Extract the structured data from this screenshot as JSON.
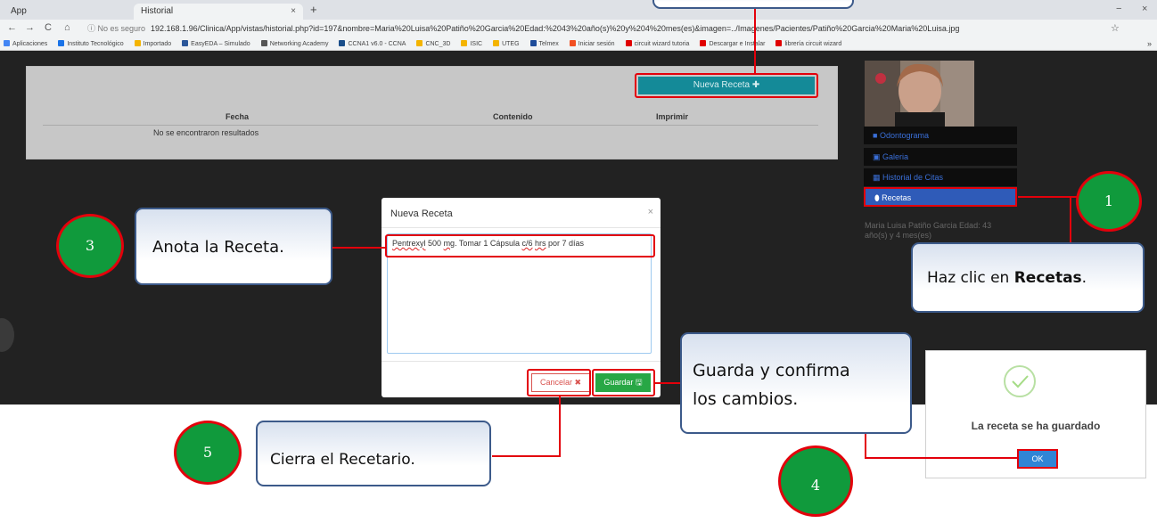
{
  "browser": {
    "tabs": [
      {
        "label": "App",
        "close": "×"
      },
      {
        "label": "Historial",
        "close": "×"
      }
    ],
    "new_tab": "+",
    "window_controls": [
      "−",
      "×"
    ],
    "nav": {
      "back": "←",
      "forward": "→",
      "reload": "C",
      "home": "⌂"
    },
    "security": "ⓘ No es seguro",
    "url": "192.168.1.96/Clinica/App/vistas/historial.php?id=197&nombre=Maria%20Luisa%20Patiño%20Garcia%20Edad:%2043%20año(s)%20y%204%20mes(es)&imagen=../Imagenes/Pacientes/Patiño%20Garcia%20Maria%20Luisa.jpg",
    "star": "☆",
    "bookmarks": [
      {
        "label": "Aplicaciones",
        "color": "#4285f4"
      },
      {
        "label": "Instituto Tecnológico",
        "color": "#1a73e8"
      },
      {
        "label": "Importado",
        "color": "#f4b400"
      },
      {
        "label": "EasyEDA – Simulado",
        "color": "#2b579a"
      },
      {
        "label": "Networking Academy",
        "color": "#555555"
      },
      {
        "label": "CCNA1 v6.0 - CCNA",
        "color": "#1a4e8a"
      },
      {
        "label": "CNC_3D",
        "color": "#f4b400"
      },
      {
        "label": "ISIC",
        "color": "#f4b400"
      },
      {
        "label": "UTEG",
        "color": "#f4b400"
      },
      {
        "label": "Telmex",
        "color": "#1e4c9a"
      },
      {
        "label": "Iniciar sesión",
        "color": "#f25022"
      },
      {
        "label": "circuit wizard tutoria",
        "color": "#e00000"
      },
      {
        "label": "Descargar e Instalar",
        "color": "#e00000"
      },
      {
        "label": "librería circuit wizard",
        "color": "#e00000"
      }
    ],
    "more": "»"
  },
  "app": {
    "new_recipe_button": "Nueva Receta ✚",
    "table_headers": [
      "Fecha",
      "Contenido",
      "Imprimir"
    ],
    "no_results": "No se encontraron resultados",
    "sidebar": [
      {
        "label": "Odontograma",
        "icon": "file-icon"
      },
      {
        "label": "Galeria",
        "icon": "image-icon"
      },
      {
        "label": "Historial de Citas",
        "icon": "calendar-icon"
      },
      {
        "label": "Recetas",
        "icon": "pill-icon"
      }
    ],
    "patient_info": "Maria Luisa Patiño Garcia Edad: 43 año(s) y 4 mes(es)"
  },
  "modal": {
    "title": "Nueva Receta",
    "close": "×",
    "recipe_parts": [
      "Pentrexyl",
      " 500 ",
      "mg",
      ". Tomar 1 Cápsula ",
      "c/6",
      " ",
      "hrs",
      " por 7 días"
    ],
    "cancel": "Cancelar ✖",
    "save": "Guardar 🖫"
  },
  "confirm": {
    "message": "La receta se ha guardado",
    "ok": "OK"
  },
  "callouts": {
    "step1_text": "Haz clic en ",
    "step1_bold": "Recetas",
    "step1_end": ".",
    "step3_text": "Anota la Receta.",
    "step4_line1": "Guarda y confirma",
    "step4_line2": "los cambios.",
    "step5_text": "Cierra el Recetario."
  },
  "steps": [
    "1",
    "3",
    "4",
    "5"
  ],
  "colors": {
    "highlight": "#e3000b",
    "step_green": "#109a3c",
    "primary": "#148a98",
    "save_green": "#28a745"
  }
}
